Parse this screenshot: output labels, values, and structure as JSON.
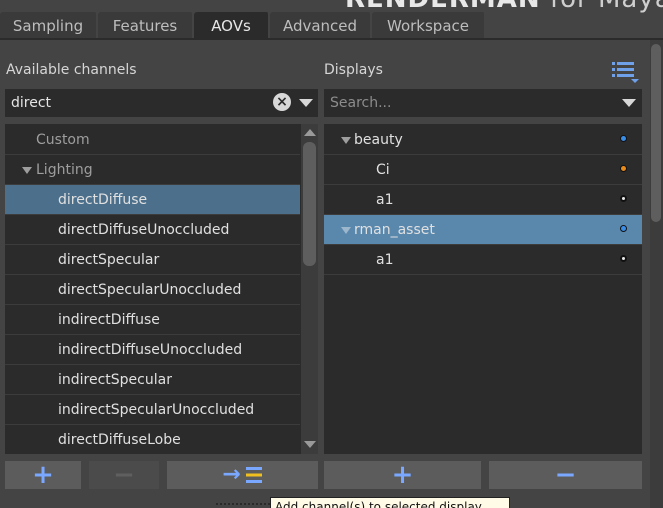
{
  "banner": {
    "brand": "RENDERMAN",
    "suffix": "for Maya"
  },
  "tabs": [
    {
      "label": "Sampling",
      "active": false
    },
    {
      "label": "Features",
      "active": false
    },
    {
      "label": "AOVs",
      "active": true
    },
    {
      "label": "Advanced",
      "active": false
    },
    {
      "label": "Workspace",
      "active": false
    }
  ],
  "available": {
    "title": "Available channels",
    "search_value": "direct",
    "search_placeholder": "",
    "items": [
      {
        "label": "Custom",
        "kind": "group-collapsed"
      },
      {
        "label": "Lighting",
        "kind": "group-expanded"
      },
      {
        "label": "directDiffuse",
        "kind": "channel",
        "selected": true
      },
      {
        "label": "directDiffuseUnoccluded",
        "kind": "channel"
      },
      {
        "label": "directSpecular",
        "kind": "channel"
      },
      {
        "label": "directSpecularUnoccluded",
        "kind": "channel"
      },
      {
        "label": "indirectDiffuse",
        "kind": "channel"
      },
      {
        "label": "indirectDiffuseUnoccluded",
        "kind": "channel"
      },
      {
        "label": "indirectSpecular",
        "kind": "channel"
      },
      {
        "label": "indirectSpecularUnoccluded",
        "kind": "channel"
      },
      {
        "label": "directDiffuseLobe",
        "kind": "channel"
      }
    ]
  },
  "displays": {
    "title": "Displays",
    "search_value": "",
    "search_placeholder": "Search...",
    "items": [
      {
        "label": "beauty",
        "kind": "display",
        "dot": "blue"
      },
      {
        "label": "Ci",
        "kind": "channel",
        "dot": "orange"
      },
      {
        "label": "a1",
        "kind": "channel",
        "dot": "white"
      },
      {
        "label": "rman_asset",
        "kind": "display",
        "dot": "blue",
        "highlighted": true
      },
      {
        "label": "a1",
        "kind": "channel",
        "dot": "white"
      }
    ]
  },
  "buttons": {
    "add_channel": "+",
    "remove_channel": "−",
    "add_to_display": "→",
    "add_display": "+",
    "remove_display": "−"
  },
  "tooltip": {
    "text": "Add channel(s) to selected display"
  },
  "colors": {
    "accent_selected": "#4c708c",
    "accent_highlight": "#5a88ad",
    "button_icon_blue": "#7aa7ff",
    "button_icon_yellow": "#f0c020",
    "dot_blue": "#3a8de6",
    "dot_orange": "#e88a1c",
    "dot_white": "#e8e8e8"
  },
  "icons": {
    "list_menu": "list-options-icon",
    "clear": "clear-search-icon",
    "dropdown": "chevron-down-icon"
  }
}
